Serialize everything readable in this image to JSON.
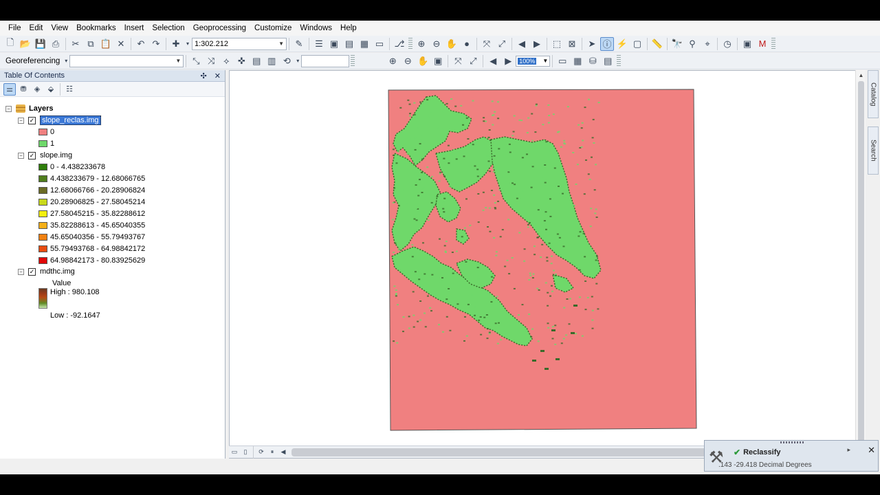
{
  "menu": [
    "File",
    "Edit",
    "View",
    "Bookmarks",
    "Insert",
    "Selection",
    "Geoprocessing",
    "Customize",
    "Windows",
    "Help"
  ],
  "toolbar": {
    "scale_value": "1:302.212",
    "georeferencing_label": "Georeferencing",
    "georef_layer_value": "",
    "georef_text_value": "",
    "zoom_value": "100%"
  },
  "toc": {
    "title": "Table Of Contents",
    "pin_glyph": "✣",
    "close_glyph": "✕",
    "layers_label": "Layers",
    "layers": [
      {
        "name": "slope_reclas.img",
        "classes": [
          {
            "label": "0",
            "color": "#f08080"
          },
          {
            "label": "1",
            "color": "#6fd86a"
          }
        ]
      },
      {
        "name": "slope.img",
        "classes": [
          {
            "label": "0 - 4.438233678",
            "color": "#2e7d0a"
          },
          {
            "label": "4.438233679 - 12.68066765",
            "color": "#4f7d1c"
          },
          {
            "label": "12.68066766 - 20.28906824",
            "color": "#6b6b25"
          },
          {
            "label": "20.28906825 - 27.58045214",
            "color": "#c8d81a"
          },
          {
            "label": "27.58045215 - 35.82288612",
            "color": "#f5f010"
          },
          {
            "label": "35.82288613 - 45.65040355",
            "color": "#f5b018"
          },
          {
            "label": "45.65040356 - 55.79493767",
            "color": "#f08010"
          },
          {
            "label": "55.79493768 - 64.98842172",
            "color": "#e84c10"
          },
          {
            "label": "64.98842173 - 80.83925629",
            "color": "#e00808"
          }
        ]
      },
      {
        "name": "mdthc.img",
        "value_label": "Value",
        "high_label": "High : 980.108",
        "low_label": "Low : -92.1647"
      }
    ]
  },
  "side_tabs": [
    "Catalog",
    "Search"
  ],
  "map": {
    "background_color": "#f08080",
    "foreground_color": "#6fd86a",
    "edge_color": "#3a6a2a"
  },
  "progress": {
    "title": "Reclassify",
    "coords": ".143  -29.418 Decimal Degrees"
  }
}
